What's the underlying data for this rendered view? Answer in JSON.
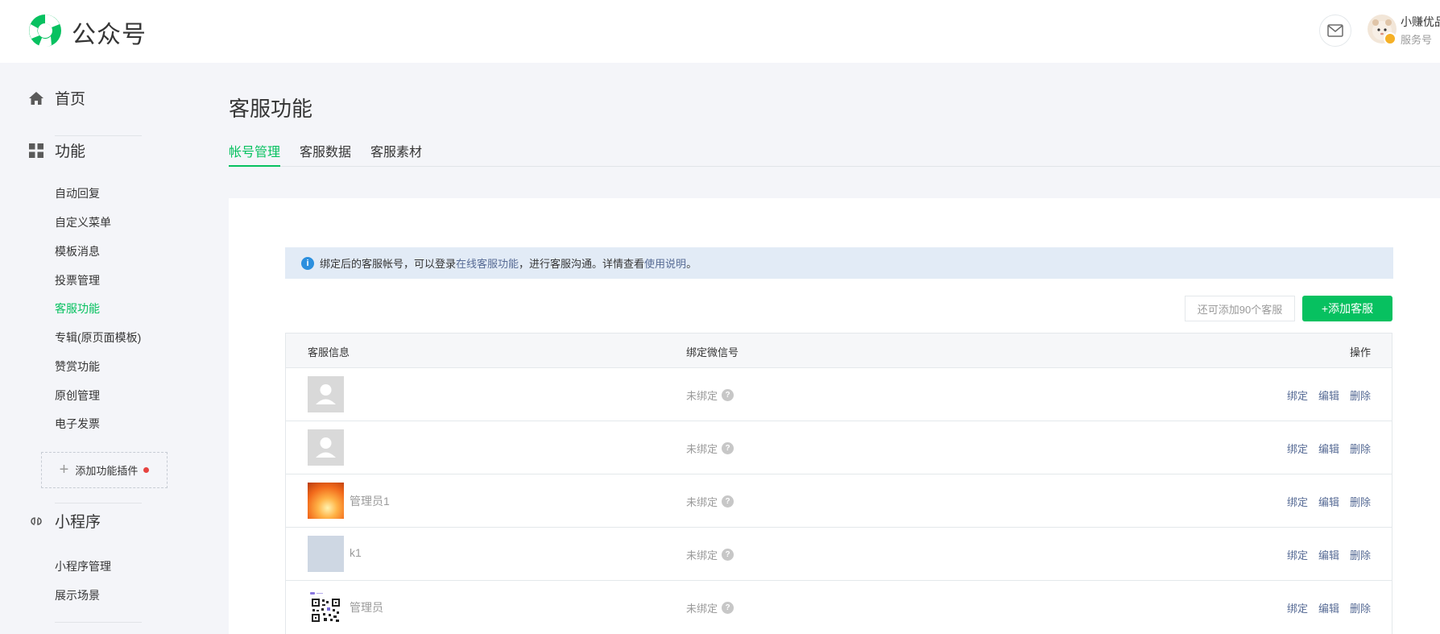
{
  "header": {
    "brand": "公众号",
    "account_name": "小赚优品",
    "account_type": "服务号"
  },
  "sidebar": {
    "home": "首页",
    "features": "功能",
    "feature_items": [
      "自动回复",
      "自定义菜单",
      "模板消息",
      "投票管理",
      "客服功能",
      "专辑(原页面模板)",
      "赞赏功能",
      "原创管理",
      "电子发票"
    ],
    "active_item": "客服功能",
    "add_plugin": "添加功能插件",
    "miniprogram": "小程序",
    "miniprogram_items": [
      "小程序管理",
      "展示场景"
    ]
  },
  "main": {
    "title": "客服功能",
    "tabs": [
      "帐号管理",
      "客服数据",
      "客服素材"
    ],
    "active_tab": "帐号管理",
    "notice": {
      "part1": "绑定后的客服帐号，可以登录",
      "link1": "在线客服功能",
      "part2": "，进行客服沟通。详情查看",
      "link2": "使用说明",
      "part3": "。"
    },
    "quota_text": "还可添加90个客服",
    "add_button": "+添加客服",
    "table": {
      "headers": [
        "客服信息",
        "绑定微信号",
        "操作"
      ],
      "rows": [
        {
          "name": "",
          "avatar": "default",
          "bind_status": "未绑定",
          "actions": [
            "绑定",
            "编辑",
            "删除"
          ]
        },
        {
          "name": "",
          "avatar": "default",
          "bind_status": "未绑定",
          "actions": [
            "绑定",
            "编辑",
            "删除"
          ]
        },
        {
          "name": "管理员1",
          "avatar": "sunset",
          "bind_status": "未绑定",
          "actions": [
            "绑定",
            "编辑",
            "删除"
          ]
        },
        {
          "name": "k1",
          "avatar": "blank",
          "bind_status": "未绑定",
          "actions": [
            "绑定",
            "编辑",
            "删除"
          ]
        },
        {
          "name": "管理员",
          "avatar": "qrcode",
          "bind_status": "未绑定",
          "actions": [
            "绑定",
            "编辑",
            "删除"
          ]
        }
      ]
    }
  },
  "colors": {
    "accent": "#07c160",
    "link": "#576b95",
    "notice_bg": "#e2ebf6",
    "info_icon": "#2b8fde",
    "plugin_dot": "#e64340"
  }
}
